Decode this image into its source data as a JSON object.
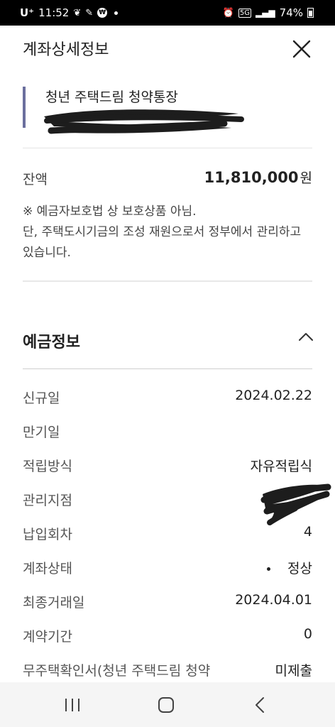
{
  "status_bar": {
    "carrier": "U⁺",
    "time": "11:52",
    "won_icon": "₩",
    "network": "5G",
    "battery": "74%"
  },
  "header": {
    "title": "계좌상세정보"
  },
  "product": {
    "name": "청년 주택드림 청약통장"
  },
  "balance": {
    "label": "잔액",
    "amount": "11,810,000",
    "unit": "원"
  },
  "notice": {
    "line1": "※ 예금자보호법 상 보호상품 아님.",
    "line2": "단, 주택도시기금의 조성 재원으로서 정부에서 관리하고 있습니다."
  },
  "deposit_info": {
    "title": "예금정보",
    "rows": [
      {
        "label": "신규일",
        "value": "2024.02.22"
      },
      {
        "label": "만기일",
        "value": ""
      },
      {
        "label": "적립방식",
        "value": "자유적립식"
      },
      {
        "label": "관리지점",
        "value": ""
      },
      {
        "label": "납입회차",
        "value": "4"
      },
      {
        "label": "계좌상태",
        "value": "정상"
      },
      {
        "label": "최종거래일",
        "value": "2024.04.01"
      },
      {
        "label": "계약기간",
        "value": "0"
      },
      {
        "label": "무주택확인서(청년 주택드림 청약",
        "value": "미제출"
      }
    ]
  },
  "icons": {
    "close": "close-icon",
    "collapse": "chevron-up-icon",
    "nav_recents": "recents-icon",
    "nav_home": "home-icon",
    "nav_back": "back-icon"
  }
}
